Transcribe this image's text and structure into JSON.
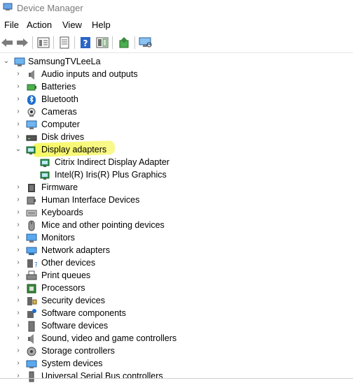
{
  "window": {
    "title": "Device Manager"
  },
  "menu": [
    "File",
    "Action",
    "View",
    "Help"
  ],
  "tree": {
    "root": "SamsungTVLeeLa",
    "items": [
      {
        "label": "Audio inputs and outputs",
        "icon": "speaker-icon"
      },
      {
        "label": "Batteries",
        "icon": "battery-icon"
      },
      {
        "label": "Bluetooth",
        "icon": "bluetooth-icon"
      },
      {
        "label": "Cameras",
        "icon": "camera-icon"
      },
      {
        "label": "Computer",
        "icon": "computer-icon"
      },
      {
        "label": "Disk drives",
        "icon": "disk-drive-icon"
      },
      {
        "label": "Display adapters",
        "icon": "display-adapter-icon",
        "expanded": true,
        "children": [
          {
            "label": "Citrix Indirect Display Adapter",
            "icon": "display-adapter-icon"
          },
          {
            "label": "Intel(R) Iris(R) Plus Graphics",
            "icon": "display-adapter-icon"
          }
        ]
      },
      {
        "label": "Firmware",
        "icon": "firmware-icon"
      },
      {
        "label": "Human Interface Devices",
        "icon": "hid-icon"
      },
      {
        "label": "Keyboards",
        "icon": "keyboard-icon"
      },
      {
        "label": "Mice and other pointing devices",
        "icon": "mouse-icon"
      },
      {
        "label": "Monitors",
        "icon": "monitor-icon"
      },
      {
        "label": "Network adapters",
        "icon": "network-adapter-icon"
      },
      {
        "label": "Other devices",
        "icon": "other-devices-icon"
      },
      {
        "label": "Print queues",
        "icon": "printer-icon"
      },
      {
        "label": "Processors",
        "icon": "processor-icon"
      },
      {
        "label": "Security devices",
        "icon": "security-device-icon"
      },
      {
        "label": "Software components",
        "icon": "software-component-icon"
      },
      {
        "label": "Software devices",
        "icon": "software-device-icon"
      },
      {
        "label": "Sound, video and game controllers",
        "icon": "sound-controller-icon"
      },
      {
        "label": "Storage controllers",
        "icon": "storage-controller-icon"
      },
      {
        "label": "System devices",
        "icon": "system-device-icon"
      },
      {
        "label": "Universal Serial Bus controllers",
        "icon": "usb-controller-icon"
      }
    ]
  },
  "colors": {
    "highlight": "#f6f752",
    "title_text": "#7a7a7a",
    "accent": "#1e6fd0"
  }
}
